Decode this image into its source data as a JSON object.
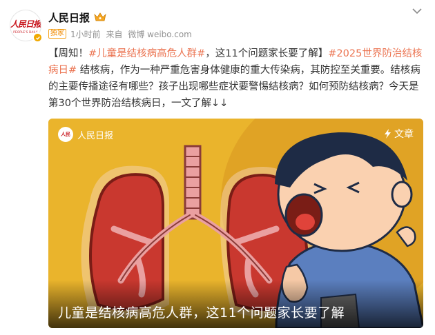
{
  "account": {
    "name": "人民日报",
    "avatar_text_cn": "人民日报",
    "avatar_text_en": "PEOPLE'S DAILY",
    "badge": "独家",
    "time": "1小时前",
    "source_prefix": "来自",
    "source": "微博 weibo.com"
  },
  "post": {
    "prefix": "【周知！",
    "tag1": "#儿童是结核病高危人群#",
    "mid1": "，这11个问题家长要了解】",
    "tag2": "#2025世界防治结核病日#",
    "body": " 结核病，作为一种严重危害身体健康的重大传染病，其防控至关重要。结核病的主要传播途径有哪些？孩子出现哪些症状要警惕结核病？如何预防结核病？今天是第30个世界防治结核病日，一文了解↓↓"
  },
  "article": {
    "source_name": "人民日报",
    "kind_label": "文章",
    "caption": "儿童是结核病高危人群，这11个问题家长要了解"
  },
  "colors": {
    "tag": "#eb7350",
    "brand_red": "#c8161d",
    "verified": "#f0a800"
  },
  "icons": {
    "verified": "verified-badge-icon",
    "crown": "crown-icon",
    "more": "chevron-down-icon",
    "article": "lightning-icon"
  }
}
